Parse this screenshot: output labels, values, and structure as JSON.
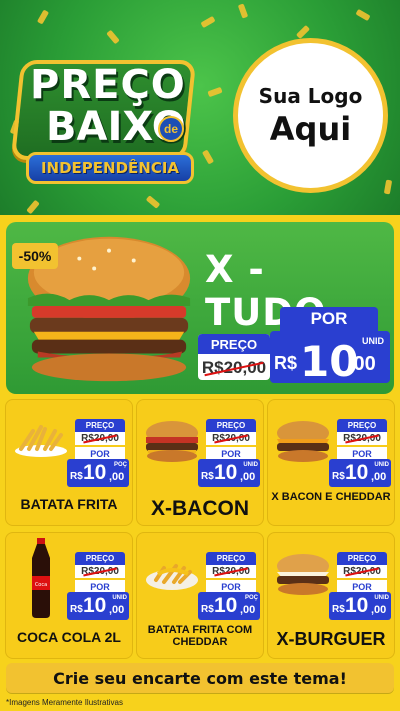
{
  "header": {
    "promo_line1": "PREÇO",
    "promo_line2": "BAIXO",
    "promo_de": "de",
    "promo_ribbon": "INDEPENDÊNCIA",
    "logo_line1": "Sua Logo",
    "logo_line2": "Aqui"
  },
  "featured": {
    "discount": "-50%",
    "title": "X - TUDO",
    "preco_label": "PREÇO",
    "old_price": "R$20,00",
    "por_label": "POR",
    "currency": "R$",
    "price_int": "10",
    "price_dec": ",00",
    "unit": "UNID"
  },
  "products": [
    {
      "name": "BATATA FRITA",
      "preco_label": "PREÇO",
      "old_price": "R$20,00",
      "por_label": "POR",
      "currency": "R$",
      "price_int": "10",
      "price_dec": ",00",
      "unit": "POÇ"
    },
    {
      "name": "X-BACON",
      "preco_label": "PREÇO",
      "old_price": "R$20,00",
      "por_label": "POR",
      "currency": "R$",
      "price_int": "10",
      "price_dec": ",00",
      "unit": "UNID"
    },
    {
      "name": "X BACON E CHEDDAR",
      "preco_label": "PREÇO",
      "old_price": "R$20,00",
      "por_label": "POR",
      "currency": "R$",
      "price_int": "10",
      "price_dec": ",00",
      "unit": "UNID"
    },
    {
      "name": "COCA COLA 2L",
      "preco_label": "PREÇO",
      "old_price": "R$20,00",
      "por_label": "POR",
      "currency": "R$",
      "price_int": "10",
      "price_dec": ",00",
      "unit": "UNID"
    },
    {
      "name": "BATATA FRITA COM CHEDDAR",
      "preco_label": "PREÇO",
      "old_price": "R$20,00",
      "por_label": "POR",
      "currency": "R$",
      "price_int": "10",
      "price_dec": ",00",
      "unit": "POÇ"
    },
    {
      "name": "X-BURGUER",
      "preco_label": "PREÇO",
      "old_price": "R$20,00",
      "por_label": "POR",
      "currency": "R$",
      "price_int": "10",
      "price_dec": ",00",
      "unit": "UNID"
    }
  ],
  "footer": {
    "cta": "Crie seu encarte com este tema!",
    "disclaimer": "*Imagens Meramente Ilustrativas"
  },
  "colors": {
    "header_green": "#2a9d36",
    "gold": "#f2c230",
    "price_blue": "#2a3fd0",
    "background_yellow": "#f7d21c"
  }
}
